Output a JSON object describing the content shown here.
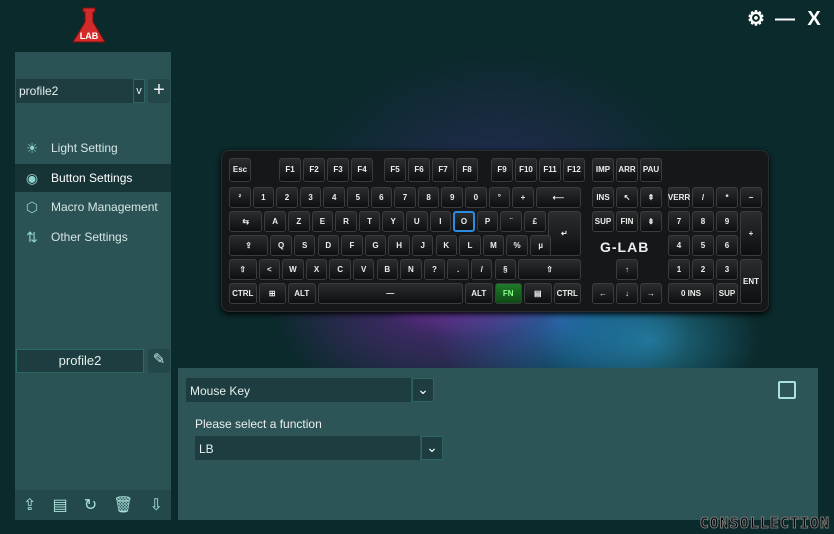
{
  "app": {
    "logo": "G-LAB flask logo",
    "brand_color": "#d42a2a"
  },
  "window": {
    "settings_icon": "gear-icon",
    "minimize_icon": "minus-icon",
    "close_icon": "close-icon",
    "minimize_label": "—",
    "close_label": "X",
    "settings_label": "⚙"
  },
  "sidebar": {
    "profile_select": {
      "value": "profile2",
      "arrow": "v"
    },
    "add_label": "+",
    "items": [
      {
        "label": "Light Setting",
        "icon": "bulb-icon",
        "glyph": "☀"
      },
      {
        "label": "Button Settings",
        "icon": "buttons-icon",
        "glyph": "◉",
        "active": true
      },
      {
        "label": "Macro Management",
        "icon": "cube-icon",
        "glyph": "⬡"
      },
      {
        "label": "Other Settings",
        "icon": "sliders-icon",
        "glyph": "⇅"
      }
    ],
    "profile_name": "profile2",
    "edit_glyph": "✎",
    "tools": [
      {
        "name": "export-icon",
        "glyph": "⇪"
      },
      {
        "name": "notes-icon",
        "glyph": "▤"
      },
      {
        "name": "refresh-file-icon",
        "glyph": "↻"
      },
      {
        "name": "trash-icon",
        "glyph": "🗑"
      },
      {
        "name": "import-icon",
        "glyph": "⇩"
      }
    ]
  },
  "keyboard": {
    "brand": "G-LAB",
    "keys": [
      "Esc",
      "F1",
      "F2",
      "F3",
      "F4",
      "F5",
      "F6",
      "F7",
      "F8",
      "F9",
      "F10",
      "F11",
      "F12",
      "IMP",
      "ARR",
      "PAU",
      "²",
      "1",
      "2",
      "3",
      "4",
      "5",
      "6",
      "7",
      "8",
      "9",
      "0",
      "°",
      "+",
      "⟵",
      "INS",
      "↖",
      "⇞",
      "VERR",
      "/",
      "*",
      "−",
      "⇆",
      "A",
      "Z",
      "E",
      "R",
      "T",
      "Y",
      "U",
      "I",
      "O",
      "P",
      "¨",
      "£",
      "↵",
      "SUP",
      "FIN",
      "⇟",
      "7",
      "8",
      "9",
      "+",
      "⇪",
      "Q",
      "S",
      "D",
      "F",
      "G",
      "H",
      "J",
      "K",
      "L",
      "M",
      "%",
      "µ",
      "4",
      "5",
      "6",
      "⇧",
      "<",
      "W",
      "X",
      "C",
      "V",
      "B",
      "N",
      "?",
      ".",
      "/",
      "§",
      "⇧",
      "↑",
      "1",
      "2",
      "3",
      "ENT",
      "CTRL",
      "⊞",
      "ALT",
      "—",
      "ALT",
      "FN",
      "▤",
      "CTRL",
      "←",
      "↓",
      "→",
      "0 INS",
      "SUP"
    ],
    "selected_key": "O",
    "active_key": "FN"
  },
  "panel": {
    "type_select": "Mouse Key",
    "function_label": "Please select a function",
    "function_select": "LB",
    "save_icon": "save-icon"
  },
  "watermark": "CONSOLLECTION"
}
